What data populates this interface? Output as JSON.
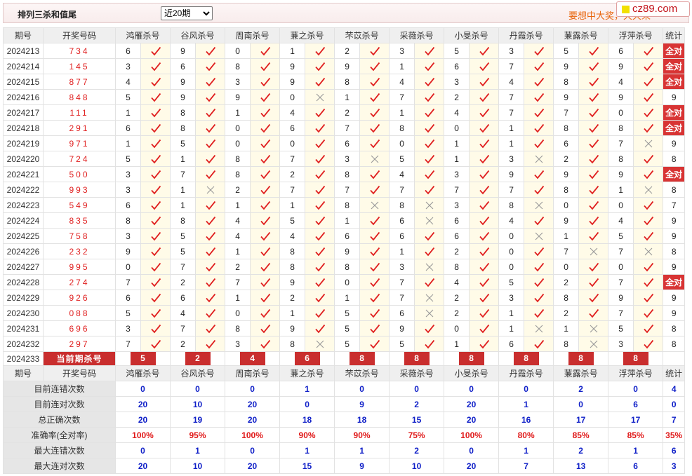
{
  "header": {
    "title": "排列三杀和值尾",
    "period_select": "近20期",
    "slogan": "要想中大奖，天天来",
    "logo_text": "cz89.com"
  },
  "columns": {
    "period": "期号",
    "draw": "开奖号码",
    "experts": [
      "鸿雁杀号",
      "谷风杀号",
      "周南杀号",
      "蒹之杀号",
      "芣苡杀号",
      "采薇杀号",
      "小旻杀号",
      "丹霞杀号",
      "蒹露杀号",
      "浮萍杀号"
    ],
    "stat": "统计"
  },
  "rows": [
    {
      "period": "2024213",
      "draw": "734",
      "kills": [
        6,
        9,
        0,
        1,
        2,
        3,
        5,
        3,
        5,
        6
      ],
      "hits": [
        1,
        1,
        1,
        1,
        1,
        1,
        1,
        1,
        1,
        1
      ],
      "stat": "全对"
    },
    {
      "period": "2024214",
      "draw": "145",
      "kills": [
        3,
        6,
        8,
        9,
        9,
        1,
        6,
        7,
        9,
        9
      ],
      "hits": [
        1,
        1,
        1,
        1,
        1,
        1,
        1,
        1,
        1,
        1
      ],
      "stat": "全对"
    },
    {
      "period": "2024215",
      "draw": "877",
      "kills": [
        4,
        9,
        3,
        9,
        8,
        4,
        3,
        4,
        8,
        4
      ],
      "hits": [
        1,
        1,
        1,
        1,
        1,
        1,
        1,
        1,
        1,
        1
      ],
      "stat": "全对"
    },
    {
      "period": "2024216",
      "draw": "848",
      "kills": [
        5,
        9,
        9,
        0,
        1,
        7,
        2,
        7,
        9,
        9
      ],
      "hits": [
        1,
        1,
        1,
        0,
        1,
        1,
        1,
        1,
        1,
        1
      ],
      "stat": "9"
    },
    {
      "period": "2024217",
      "draw": "111",
      "kills": [
        1,
        8,
        1,
        4,
        2,
        1,
        4,
        7,
        7,
        0
      ],
      "hits": [
        1,
        1,
        1,
        1,
        1,
        1,
        1,
        1,
        1,
        1
      ],
      "stat": "全对"
    },
    {
      "period": "2024218",
      "draw": "291",
      "kills": [
        6,
        8,
        0,
        6,
        7,
        8,
        0,
        1,
        8,
        8
      ],
      "hits": [
        1,
        1,
        1,
        1,
        1,
        1,
        1,
        1,
        1,
        1
      ],
      "stat": "全对"
    },
    {
      "period": "2024219",
      "draw": "971",
      "kills": [
        1,
        5,
        0,
        0,
        6,
        0,
        1,
        1,
        6,
        7
      ],
      "hits": [
        1,
        1,
        1,
        1,
        1,
        1,
        1,
        1,
        1,
        0
      ],
      "stat": "9"
    },
    {
      "period": "2024220",
      "draw": "724",
      "kills": [
        5,
        1,
        8,
        7,
        3,
        5,
        1,
        3,
        2,
        8
      ],
      "hits": [
        1,
        1,
        1,
        1,
        0,
        1,
        1,
        0,
        1,
        1
      ],
      "stat": "8"
    },
    {
      "period": "2024221",
      "draw": "500",
      "kills": [
        3,
        7,
        8,
        2,
        8,
        4,
        3,
        9,
        9,
        9
      ],
      "hits": [
        1,
        1,
        1,
        1,
        1,
        1,
        1,
        1,
        1,
        1
      ],
      "stat": "全对"
    },
    {
      "period": "2024222",
      "draw": "993",
      "kills": [
        3,
        1,
        2,
        7,
        7,
        7,
        7,
        7,
        8,
        1
      ],
      "hits": [
        1,
        0,
        1,
        1,
        1,
        1,
        1,
        1,
        1,
        0
      ],
      "stat": "8"
    },
    {
      "period": "2024223",
      "draw": "549",
      "kills": [
        6,
        1,
        1,
        1,
        8,
        8,
        3,
        8,
        0,
        0
      ],
      "hits": [
        1,
        1,
        1,
        1,
        0,
        0,
        1,
        0,
        1,
        1
      ],
      "stat": "7"
    },
    {
      "period": "2024224",
      "draw": "835",
      "kills": [
        8,
        8,
        4,
        5,
        1,
        6,
        6,
        4,
        9,
        4
      ],
      "hits": [
        1,
        1,
        1,
        1,
        1,
        0,
        1,
        1,
        1,
        1
      ],
      "stat": "9"
    },
    {
      "period": "2024225",
      "draw": "758",
      "kills": [
        3,
        5,
        4,
        4,
        6,
        6,
        6,
        0,
        1,
        5
      ],
      "hits": [
        1,
        1,
        1,
        1,
        1,
        1,
        1,
        0,
        1,
        1
      ],
      "stat": "9"
    },
    {
      "period": "2024226",
      "draw": "232",
      "kills": [
        9,
        5,
        1,
        8,
        9,
        1,
        2,
        0,
        7,
        7
      ],
      "hits": [
        1,
        1,
        1,
        1,
        1,
        1,
        1,
        1,
        0,
        0
      ],
      "stat": "8"
    },
    {
      "period": "2024227",
      "draw": "995",
      "kills": [
        0,
        7,
        2,
        8,
        8,
        3,
        8,
        0,
        0,
        0
      ],
      "hits": [
        1,
        1,
        1,
        1,
        1,
        0,
        1,
        1,
        1,
        1
      ],
      "stat": "9"
    },
    {
      "period": "2024228",
      "draw": "274",
      "kills": [
        7,
        2,
        7,
        9,
        0,
        7,
        4,
        5,
        2,
        7
      ],
      "hits": [
        1,
        1,
        1,
        1,
        1,
        1,
        1,
        1,
        1,
        1
      ],
      "stat": "全对"
    },
    {
      "period": "2024229",
      "draw": "926",
      "kills": [
        6,
        6,
        1,
        2,
        1,
        7,
        2,
        3,
        8,
        9
      ],
      "hits": [
        1,
        1,
        1,
        1,
        1,
        0,
        1,
        1,
        1,
        1
      ],
      "stat": "9"
    },
    {
      "period": "2024230",
      "draw": "088",
      "kills": [
        5,
        4,
        0,
        1,
        5,
        6,
        2,
        1,
        2,
        7
      ],
      "hits": [
        1,
        1,
        1,
        1,
        1,
        0,
        1,
        1,
        1,
        1
      ],
      "stat": "9"
    },
    {
      "period": "2024231",
      "draw": "696",
      "kills": [
        3,
        7,
        8,
        9,
        5,
        9,
        0,
        1,
        1,
        5
      ],
      "hits": [
        1,
        1,
        1,
        1,
        1,
        1,
        1,
        0,
        0,
        1
      ],
      "stat": "8"
    },
    {
      "period": "2024232",
      "draw": "297",
      "kills": [
        7,
        2,
        3,
        8,
        5,
        5,
        1,
        6,
        8,
        3
      ],
      "hits": [
        1,
        1,
        1,
        0,
        1,
        1,
        1,
        1,
        0,
        1
      ],
      "stat": "8"
    }
  ],
  "current": {
    "period": "2024233",
    "label": "当前期杀号",
    "kills": [
      5,
      2,
      4,
      6,
      8,
      8,
      8,
      8,
      8,
      8
    ]
  },
  "summary": [
    {
      "label": "目前连错次数",
      "values": [
        "0",
        "0",
        "0",
        "1",
        "0",
        "0",
        "0",
        "0",
        "2",
        "0"
      ],
      "stat": "4"
    },
    {
      "label": "目前连对次数",
      "values": [
        "20",
        "10",
        "20",
        "0",
        "9",
        "2",
        "20",
        "1",
        "0",
        "6"
      ],
      "stat": "0"
    },
    {
      "label": "总正确次数",
      "values": [
        "20",
        "19",
        "20",
        "18",
        "18",
        "15",
        "20",
        "16",
        "17",
        "17"
      ],
      "stat": "7"
    },
    {
      "label": "准确率(全对率)",
      "values": [
        "100%",
        "95%",
        "100%",
        "90%",
        "90%",
        "75%",
        "100%",
        "80%",
        "85%",
        "85%"
      ],
      "stat": "35%",
      "red": true
    },
    {
      "label": "最大连错次数",
      "values": [
        "0",
        "1",
        "0",
        "1",
        "1",
        "2",
        "0",
        "1",
        "2",
        "1"
      ],
      "stat": "6"
    },
    {
      "label": "最大连对次数",
      "values": [
        "20",
        "10",
        "20",
        "15",
        "9",
        "10",
        "20",
        "7",
        "13",
        "6"
      ],
      "stat": "3"
    }
  ],
  "colors": {
    "accent": "#c92e2e",
    "hit": "#e02020",
    "miss": "#999999",
    "summary_value": "#1020c8"
  }
}
